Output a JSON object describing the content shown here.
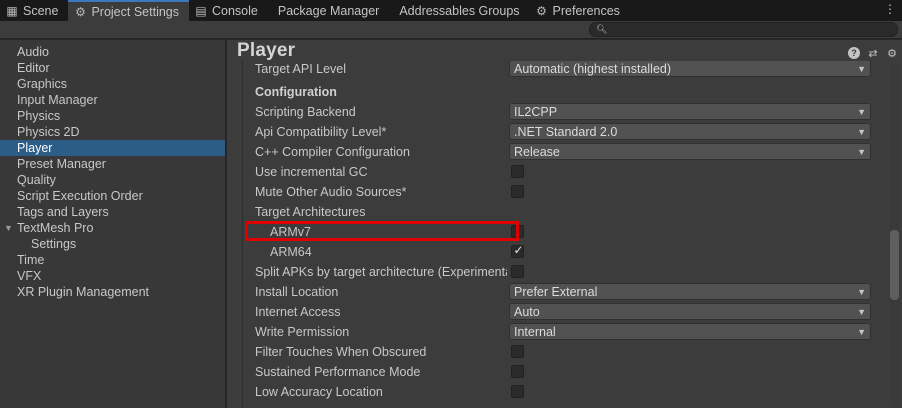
{
  "tabs": [
    {
      "label": "Scene",
      "icon": "scene-icon",
      "glyph": "▦"
    },
    {
      "label": "Project Settings",
      "icon": "gear-icon",
      "glyph": "⚙"
    },
    {
      "label": "Console",
      "icon": "console-icon",
      "glyph": "▤"
    },
    {
      "label": "Package Manager",
      "icon": "",
      "glyph": ""
    },
    {
      "label": "Addressables Groups",
      "icon": "",
      "glyph": ""
    },
    {
      "label": "Preferences",
      "icon": "gear-icon",
      "glyph": "⚙"
    }
  ],
  "active_tab": "Project Settings",
  "search": {
    "placeholder": "",
    "icon": "search-icon"
  },
  "sidebar": {
    "items": [
      {
        "label": "Audio"
      },
      {
        "label": "Editor"
      },
      {
        "label": "Graphics"
      },
      {
        "label": "Input Manager"
      },
      {
        "label": "Physics"
      },
      {
        "label": "Physics 2D"
      },
      {
        "label": "Player",
        "selected": true
      },
      {
        "label": "Preset Manager"
      },
      {
        "label": "Quality"
      },
      {
        "label": "Script Execution Order"
      },
      {
        "label": "Tags and Layers"
      },
      {
        "label": "TextMesh Pro",
        "foldout": true
      },
      {
        "label": "Settings",
        "child": true
      },
      {
        "label": "Time"
      },
      {
        "label": "VFX"
      },
      {
        "label": "XR Plugin Management"
      }
    ]
  },
  "main": {
    "title": "Player",
    "rows": [
      {
        "label": "Target API Level",
        "type": "dropdown",
        "value": "Automatic (highest installed)"
      },
      {
        "label": "Configuration",
        "type": "header"
      },
      {
        "label": "Scripting Backend",
        "type": "dropdown",
        "value": "IL2CPP"
      },
      {
        "label": "Api Compatibility Level*",
        "type": "dropdown",
        "value": ".NET Standard 2.0"
      },
      {
        "label": "C++ Compiler Configuration",
        "type": "dropdown",
        "value": "Release"
      },
      {
        "label": "Use incremental GC",
        "type": "checkbox",
        "checked": false
      },
      {
        "label": "Mute Other Audio Sources*",
        "type": "checkbox",
        "checked": false
      },
      {
        "label": "Target Architectures",
        "type": "label"
      },
      {
        "label": "ARMv7",
        "type": "checkbox",
        "checked": false,
        "indent": true
      },
      {
        "label": "ARM64",
        "type": "checkbox",
        "checked": true,
        "indent": true
      },
      {
        "label": "Split APKs by target architecture (Experimental)",
        "type": "checkbox",
        "checked": false
      },
      {
        "label": "Install Location",
        "type": "dropdown",
        "value": "Prefer External"
      },
      {
        "label": "Internet Access",
        "type": "dropdown",
        "value": "Auto"
      },
      {
        "label": "Write Permission",
        "type": "dropdown",
        "value": "Internal"
      },
      {
        "label": "Filter Touches When Obscured",
        "type": "checkbox",
        "checked": false
      },
      {
        "label": "Sustained Performance Mode",
        "type": "checkbox",
        "checked": false
      },
      {
        "label": "Low Accuracy Location",
        "type": "checkbox",
        "checked": false
      }
    ]
  },
  "colors": {
    "selection": "#2c5d87",
    "highlight_box": "#e00000",
    "accent": "#3a79bb"
  }
}
